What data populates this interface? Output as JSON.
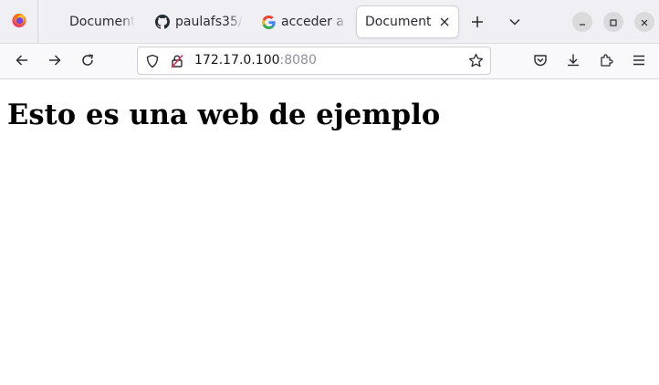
{
  "browser": {
    "tabs": [
      {
        "title": "Document",
        "favicon": "blank",
        "active": false
      },
      {
        "title": "paulafs35/",
        "favicon": "github-icon",
        "active": false
      },
      {
        "title": "acceder a v",
        "favicon": "google-icon",
        "active": false
      },
      {
        "title": "Document",
        "favicon": "blank",
        "active": true
      }
    ],
    "url": {
      "host": "172.17.0.100",
      "port": ":8080"
    },
    "colors": {
      "tabbar_bg": "#f0f0f4",
      "toolbar_bg": "#f9f9fb",
      "icon": "#2b2a33",
      "insecure_slash": "#e22850"
    }
  },
  "page": {
    "heading": "Esto es una web de ejemplo"
  }
}
